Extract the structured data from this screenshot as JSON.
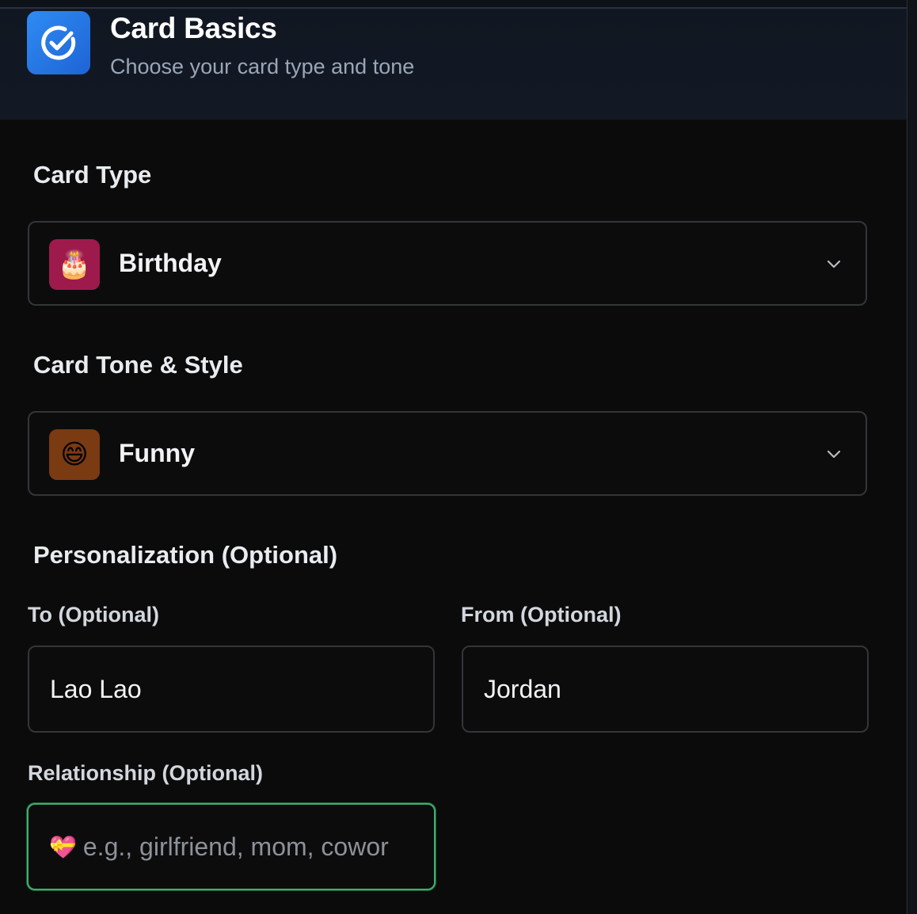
{
  "header": {
    "title": "Card Basics",
    "subtitle": "Choose your card type and tone",
    "icon": "check-circle-icon",
    "accent": "#2f8cf3"
  },
  "card_type": {
    "label": "Card Type",
    "value": "Birthday",
    "emoji": "🎂",
    "emoji_bg": "#9e1a4d"
  },
  "card_tone": {
    "label": "Card Tone & Style",
    "value": "Funny",
    "emoji": "😄",
    "emoji_bg": "#7a3a12"
  },
  "personalization": {
    "heading": "Personalization (Optional)",
    "to": {
      "label": "To (Optional)",
      "value": "Lao Lao"
    },
    "from": {
      "label": "From (Optional)",
      "value": "Jordan"
    },
    "relationship": {
      "label": "Relationship (Optional)",
      "emoji": "💝",
      "placeholder": "e.g., girlfriend, mom, cowor",
      "focus_color": "#3fae6b"
    }
  }
}
